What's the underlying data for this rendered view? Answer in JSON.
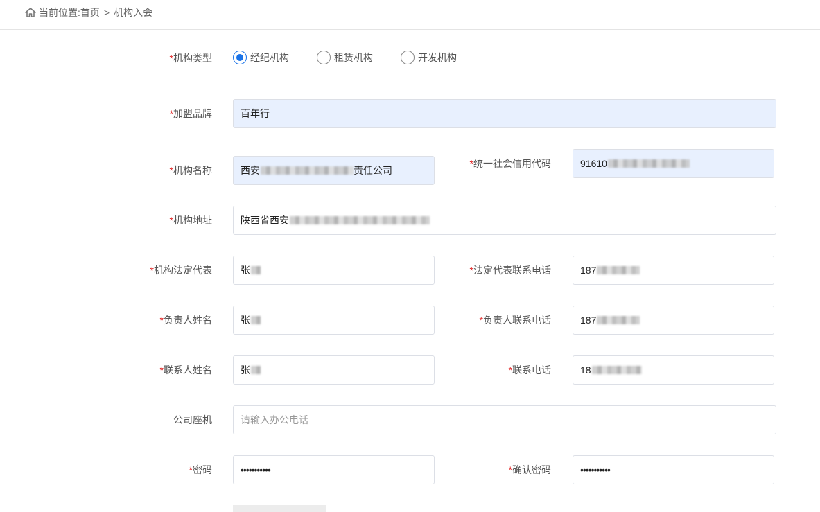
{
  "breadcrumb": {
    "prefix": "当前位置:",
    "home": "首页",
    "separator": ">",
    "current": "机构入会"
  },
  "form": {
    "org_type": {
      "label": "机构类型",
      "options": [
        "经纪机构",
        "租赁机构",
        "开发机构"
      ],
      "selected": "经纪机构"
    },
    "brand": {
      "label": "加盟品牌",
      "value": "百年行"
    },
    "org_name": {
      "label": "机构名称",
      "value_start": "西安",
      "value_end": "责任公司"
    },
    "credit_code": {
      "label": "统一社会信用代码",
      "value": "91610"
    },
    "address": {
      "label": "机构地址",
      "value": "陕西省西安"
    },
    "legal_rep": {
      "label": "机构法定代表",
      "value": "张"
    },
    "legal_rep_phone": {
      "label": "法定代表联系电话",
      "value": "187"
    },
    "manager_name": {
      "label": "负责人姓名",
      "value": "张"
    },
    "manager_phone": {
      "label": "负责人联系电话",
      "value": "187"
    },
    "contact_name": {
      "label": "联系人姓名",
      "value": "张"
    },
    "contact_phone": {
      "label": "联系电话",
      "value": "18"
    },
    "office_phone": {
      "label": "公司座机",
      "placeholder": "请输入办公电话"
    },
    "password": {
      "label": "密码",
      "value": "•••••••••••"
    },
    "confirm_password": {
      "label": "确认密码",
      "value": "•••••••••••"
    },
    "required_mark": "*"
  },
  "colors": {
    "accent": "#1a73e8",
    "required": "#e02020",
    "autofill_bg": "#e8f0fe"
  }
}
